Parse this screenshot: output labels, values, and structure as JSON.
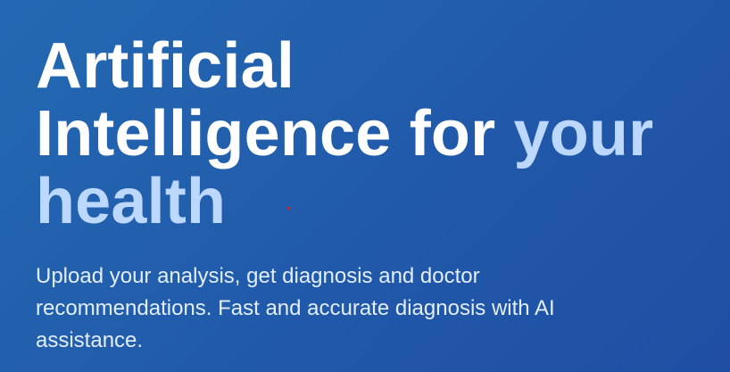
{
  "hero": {
    "title_line1": "Artificial",
    "title_line2_main": "Intelligence for",
    "title_line2_accent": "your",
    "title_line3_accent": "health",
    "subtitle": "Upload your analysis, get diagnosis and doctor recommendations. Fast and accurate diagnosis with AI assistance."
  },
  "colors": {
    "background_start": "#2369b2",
    "background_end": "#1f4ea3",
    "title": "#ffffff",
    "accent": "#bcd8ff",
    "subtitle": "#e3eefb"
  }
}
